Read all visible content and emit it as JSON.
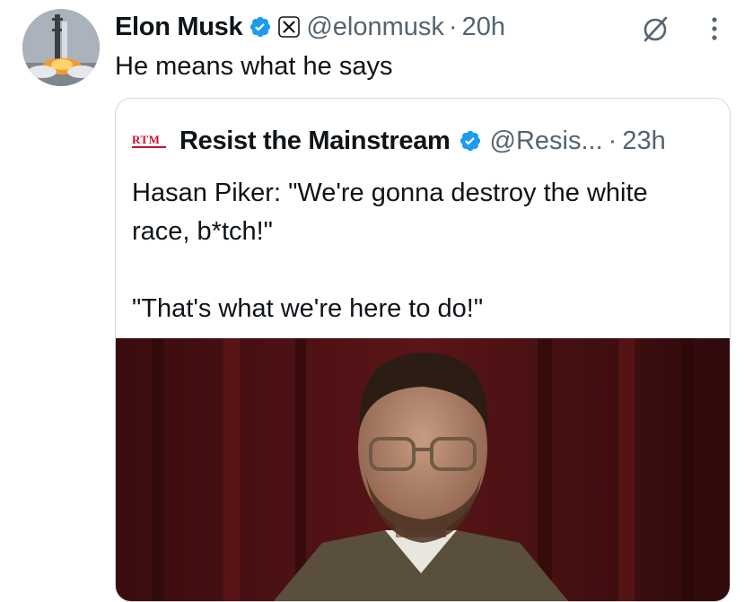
{
  "tweet": {
    "author_name": "Elon Musk",
    "handle": "@elonmusk",
    "separator": "·",
    "time": "20h",
    "text": "He means what he says"
  },
  "quote": {
    "logo_text": "RTM",
    "author_name": "Resist the Mainstream",
    "handle": "@Resis...",
    "separator": "·",
    "time": "23h",
    "text_line1": "Hasan Piker: \"We're gonna destroy the white",
    "text_line2": "race, b*tch!\"",
    "text_line3": "\"That's what we're here to do!\""
  },
  "colors": {
    "verified_blue": "#1d9bf0",
    "secondary_text": "#536471",
    "brand_red": "#c8102e"
  },
  "icons": {
    "verified": "verified-badge-icon",
    "x_affiliate": "x-logo-icon",
    "grok": "grok-icon",
    "more": "more-vertical-icon"
  }
}
